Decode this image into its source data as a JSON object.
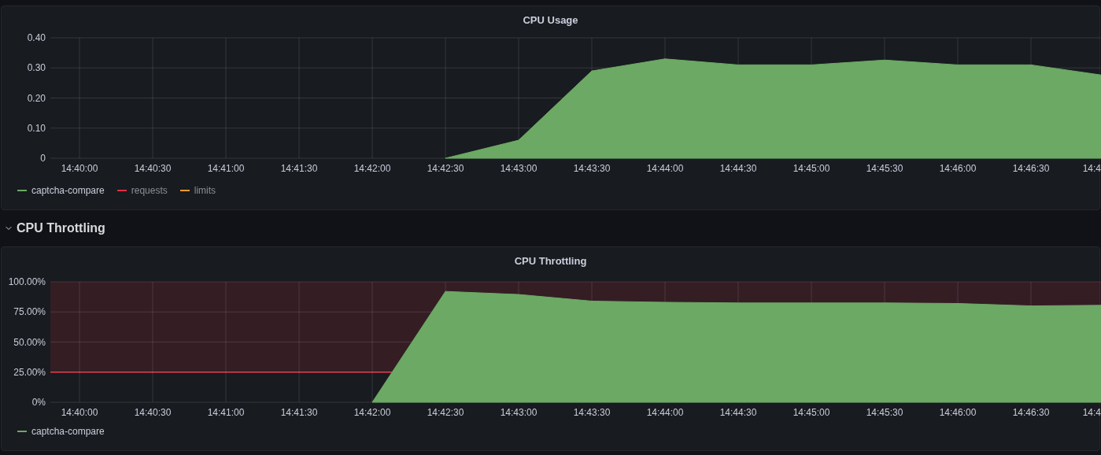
{
  "panels": [
    {
      "chart_data": {
        "type": "area",
        "title": "CPU Usage",
        "grid": true,
        "categories": [
          "14:40:00",
          "14:40:30",
          "14:41:00",
          "14:41:30",
          "14:42:00",
          "14:42:30",
          "14:43:00",
          "14:43:30",
          "14:44:00",
          "14:44:30",
          "14:45:00",
          "14:45:30",
          "14:46:00",
          "14:46:30",
          "14:4"
        ],
        "series": [
          {
            "name": "captcha-compare",
            "color": "#6ca965",
            "values": [
              null,
              null,
              null,
              null,
              null,
              0,
              0.06,
              0.29,
              0.33,
              0.31,
              0.31,
              0.326,
              0.31,
              0.31,
              0.275
            ]
          }
        ],
        "ylim": [
          0,
          0.4
        ],
        "yticks": [
          {
            "value": 0,
            "label": "0"
          },
          {
            "value": 0.1,
            "label": "0.10"
          },
          {
            "value": 0.2,
            "label": "0.20"
          },
          {
            "value": 0.3,
            "label": "0.30"
          },
          {
            "value": 0.4,
            "label": "0.40"
          }
        ]
      },
      "legend": [
        {
          "label": "requests",
          "color": "#e02f44",
          "hidden": true
        },
        {
          "label": "limits",
          "color": "#ff9830",
          "hidden": true
        }
      ]
    },
    {
      "row_title": "CPU Throttling",
      "expanded": true,
      "chart_data": {
        "type": "area",
        "title": "CPU Throttling",
        "grid": true,
        "categories": [
          "14:40:00",
          "14:40:30",
          "14:41:00",
          "14:41:30",
          "14:42:00",
          "14:42:30",
          "14:43:00",
          "14:43:30",
          "14:44:00",
          "14:44:30",
          "14:45:00",
          "14:45:30",
          "14:46:00",
          "14:46:30",
          "14:4"
        ],
        "series": [
          {
            "name": "captcha-compare",
            "color": "#6ca965",
            "values": [
              null,
              null,
              null,
              null,
              0,
              92,
              89.5,
              84,
              83,
              82.5,
              82.5,
              82.5,
              82,
              80,
              80.5
            ]
          }
        ],
        "ylim": [
          0,
          100
        ],
        "yticks": [
          {
            "value": 0,
            "label": "0%"
          },
          {
            "value": 25,
            "label": "25.00%"
          },
          {
            "value": 50,
            "label": "50.00%"
          },
          {
            "value": 75,
            "label": "75.00%"
          },
          {
            "value": 100,
            "label": "100.00%"
          }
        ],
        "ref_lines": [
          {
            "axis": "y",
            "value": 25,
            "color": "#e02f44"
          }
        ],
        "bands": [
          {
            "axis": "y",
            "from": 25,
            "to": 100,
            "color": "#e02f44"
          }
        ]
      }
    }
  ]
}
